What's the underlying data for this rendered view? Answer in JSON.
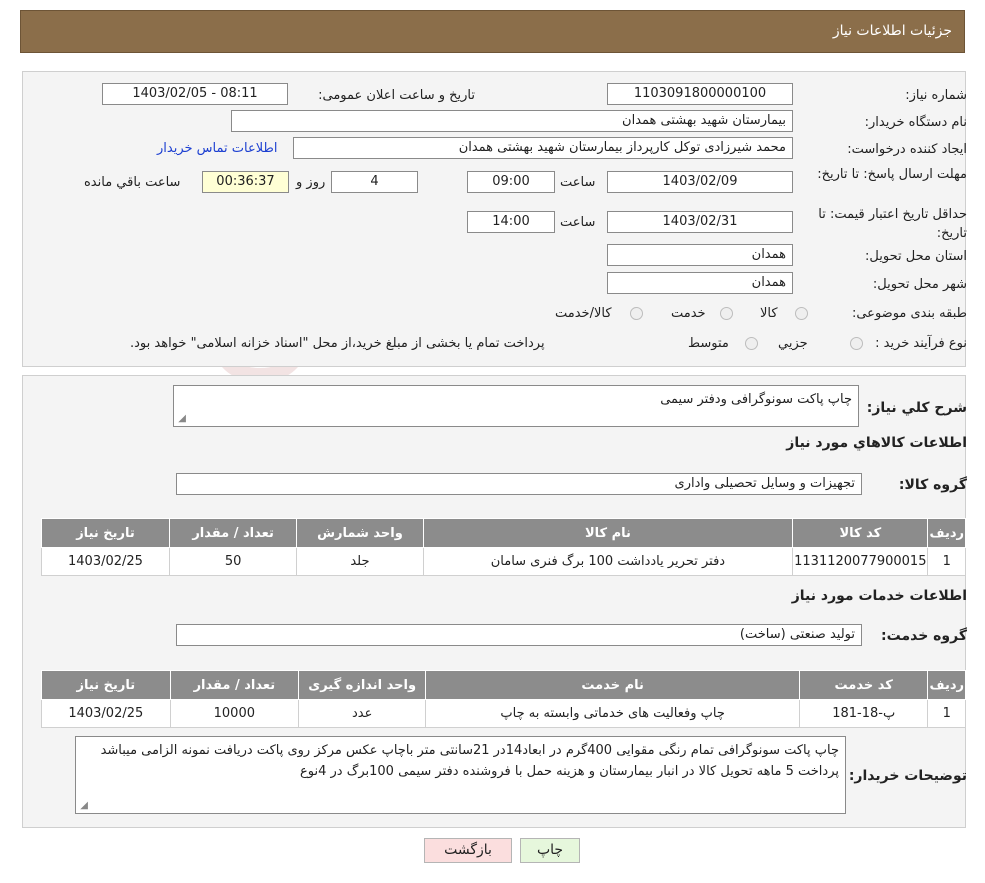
{
  "header": {
    "title": "جزئیات اطلاعات نیاز"
  },
  "info": {
    "need_number_label": "شماره نیاز:",
    "need_number": "1103091800000100",
    "announce_label": "تاریخ و ساعت اعلان عمومی:",
    "announce_value": "1403/02/05 - 08:11",
    "buyer_label": "نام دستگاه خریدار:",
    "buyer_value": "بیمارستان شهید بهشتی همدان",
    "creator_label": "ایجاد کننده درخواست:",
    "creator_value": "محمد شیرزادی توکل کارپرداز بیمارستان شهید بهشتی همدان",
    "contact_link": "اطلاعات تماس خریدار",
    "deadline_label": "مهلت ارسال پاسخ: تا تاریخ:",
    "deadline_date": "1403/02/09",
    "time_label": "ساعت",
    "deadline_time": "09:00",
    "days_value": "4",
    "days_label": "روز و",
    "remaining_value": "00:36:37",
    "remaining_label": "ساعت باقي مانده",
    "validity_label": "حداقل تاريخ اعتبار قيمت: تا تاریخ:",
    "validity_date": "1403/02/31",
    "validity_time": "14:00",
    "province_label": "استان محل تحویل:",
    "province_value": "همدان",
    "city_label": "شهر محل تحویل:",
    "city_value": "همدان",
    "category_label": "طبقه بندی موضوعی:",
    "category_options": [
      "کالا",
      "خدمت",
      "کالا/خدمت"
    ],
    "process_label": "نوع فرآیند خرید :",
    "process_options": [
      "جزيي",
      "متوسط"
    ],
    "process_note": "پرداخت تمام یا بخشی از مبلغ خرید،از محل \"اسناد خزانه اسلامی\" خواهد بود."
  },
  "details": {
    "summary_label": "شرح کلي نياز:",
    "summary_value": "چاپ پاکت سونوگرافی  ودفتر سیمی",
    "goods_section": "اطلاعات کالاهاي مورد نياز",
    "goods_group_label": "گروه کالا:",
    "goods_group_value": "تجهیزات و وسایل تحصیلی واداری",
    "goods_headers": [
      "رديف",
      "کد کالا",
      "نام کالا",
      "واحد شمارش",
      "تعداد / مقدار",
      "تاريخ نياز"
    ],
    "goods_rows": [
      [
        "1",
        "1131120077900015",
        "دفتر تحریر یادداشت 100 برگ فنری سامان",
        "جلد",
        "50",
        "1403/02/25"
      ]
    ],
    "services_section": "اطلاعات خدمات مورد نياز",
    "service_group_label": "گروه خدمت:",
    "service_group_value": "تولید صنعتی (ساخت)",
    "service_headers": [
      "رديف",
      "کد خدمت",
      "نام خدمت",
      "واحد اندازه گیری",
      "تعداد / مقدار",
      "تاريخ نياز"
    ],
    "service_rows": [
      [
        "1",
        "پ-18-181",
        "چاپ وفعالیت های خدماتی وابسته به چاپ",
        "عدد",
        "10000",
        "1403/02/25"
      ]
    ],
    "buyer_notes_label": "توضیحات خریدار:",
    "buyer_notes_value": "چاپ پاکت سونوگرافی  تمام رنگی مقوایی 400گرم در ابعاد14در 21سانتی متر باچاپ عکس مرکز روی پاکت دریافت نمونه الزامی میباشد پرداخت 5 ماهه  تحویل کالا در انبار بیمارستان و هزینه حمل با فروشنده دفتر سیمی 100برگ در 4نوع"
  },
  "buttons": {
    "print": "چاپ",
    "back": "بازگشت"
  },
  "colors": {
    "header": "#8b6e4a",
    "table_header": "#8c8c8c",
    "link": "#1c3fd1"
  }
}
